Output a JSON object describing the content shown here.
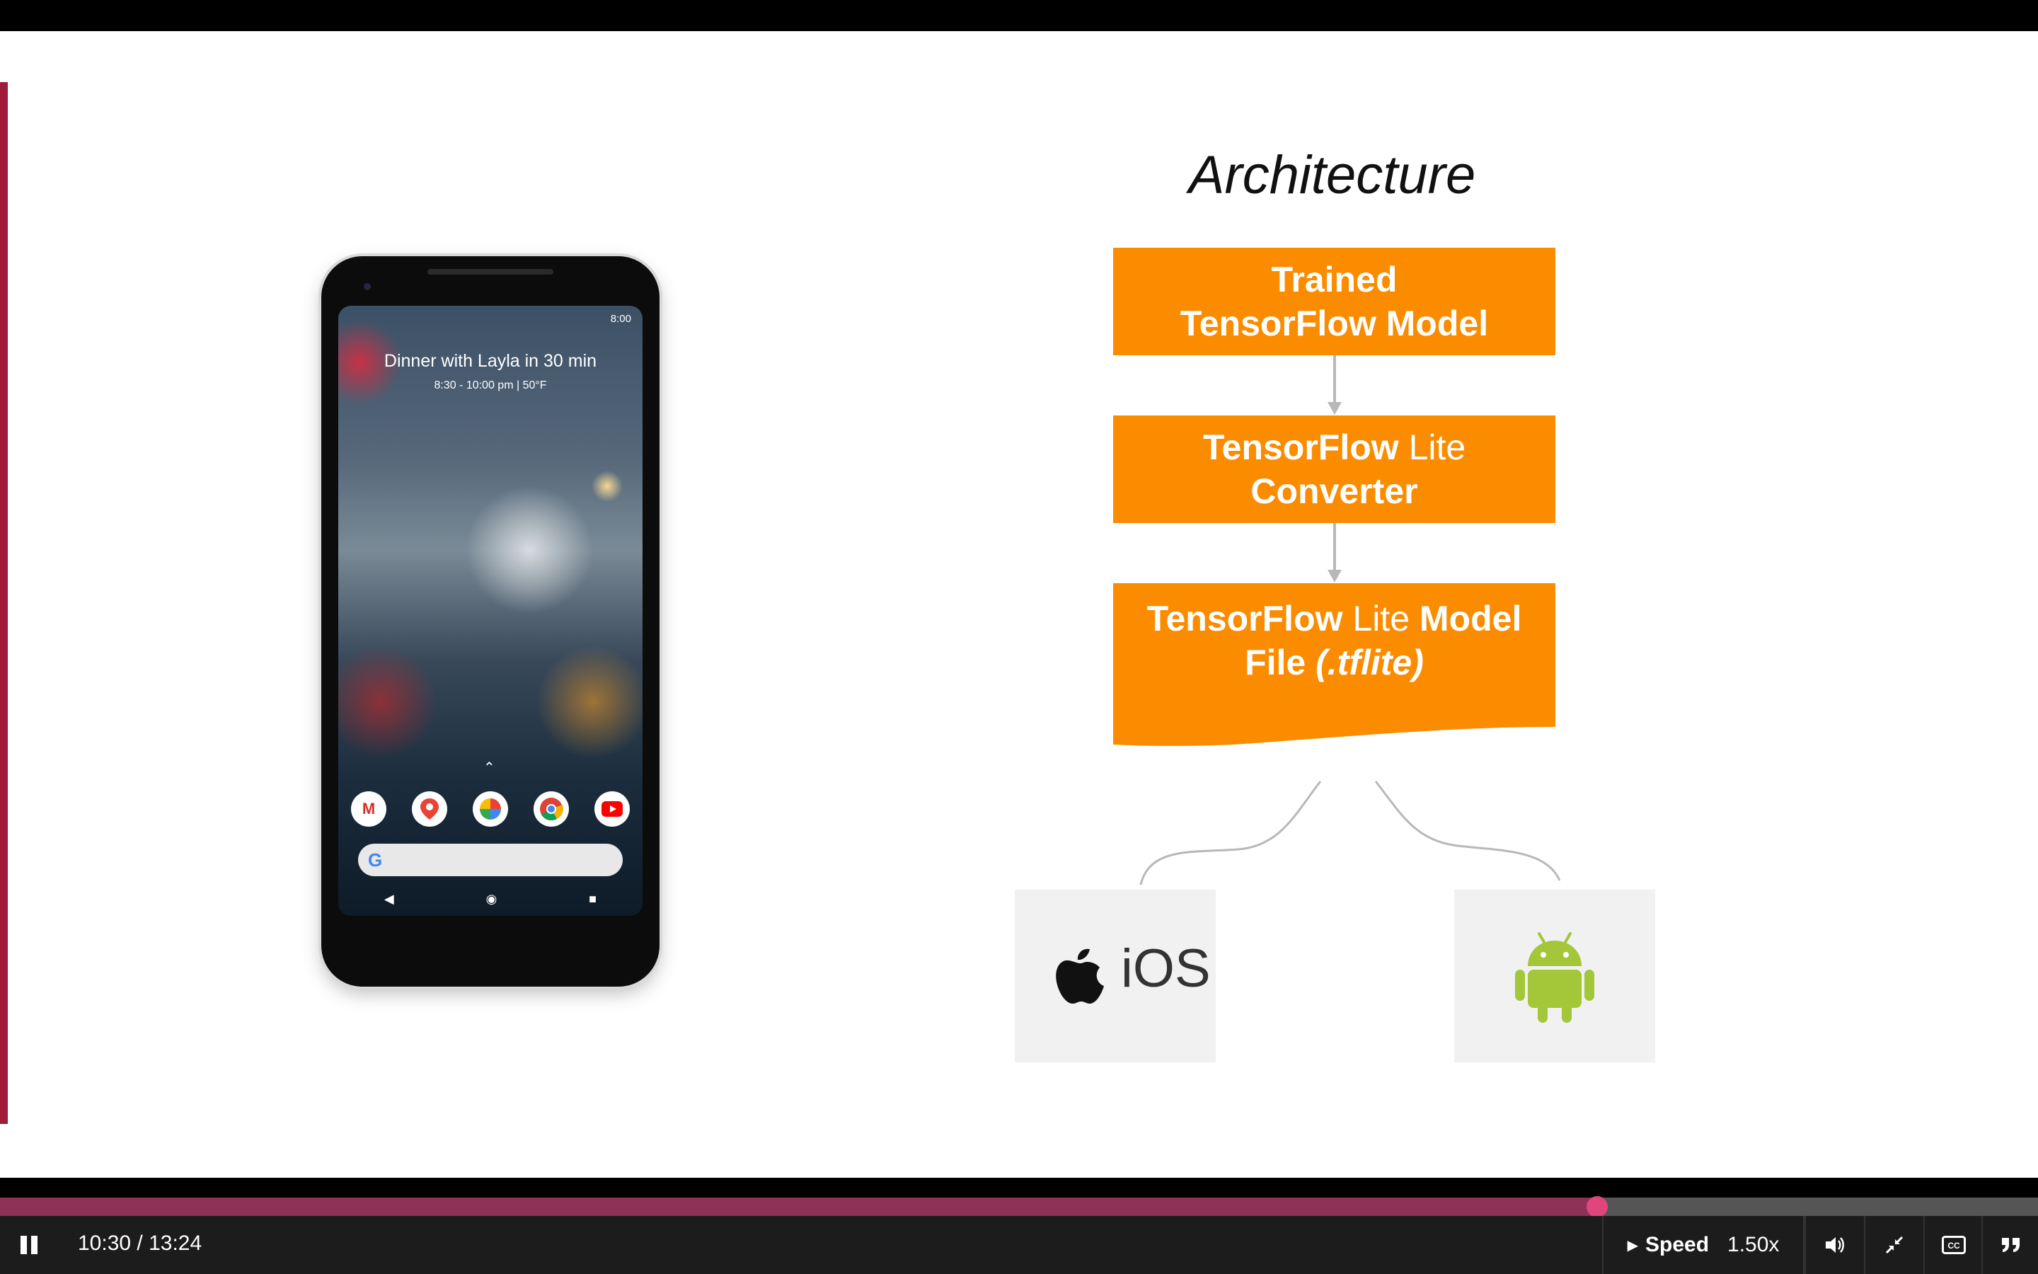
{
  "colors": {
    "accent": "#9e1b3a",
    "box_orange": "#fb8c00",
    "progress_played": "#8e3257",
    "scrubber": "#e0457b",
    "connector_gray": "#b8b8b8",
    "android_green": "#a4c639"
  },
  "slide": {
    "title": "Architecture",
    "boxes": [
      {
        "bold1": "Trained",
        "light1": "",
        "bold2": "TensorFlow Model",
        "light2": "",
        "italic2": ""
      },
      {
        "bold1": "TensorFlow",
        "light1": " Lite",
        "bold2": "Converter",
        "light2": "",
        "italic2": ""
      },
      {
        "bold1": "TensorFlow",
        "light1": " Lite ",
        "bold1b": "Model",
        "bold2": "File ",
        "italic2": "(.tflite)"
      }
    ],
    "platforms": {
      "ios": {
        "label": "iOS",
        "icon": "apple-icon"
      },
      "android": {
        "icon": "android-icon"
      }
    },
    "phone": {
      "status_time": "8:00",
      "event_title": "Dinner with Layla in 30 min",
      "event_detail": "8:30 - 10:00 pm  |  50°F",
      "dock_apps": [
        "gmail-icon",
        "maps-icon",
        "photos-icon",
        "chrome-icon",
        "youtube-icon"
      ],
      "search_logo": "G"
    }
  },
  "player": {
    "current_time": "10:30",
    "total_time": "13:24",
    "time_display": "10:30 / 13:24",
    "progress": 0.7836,
    "speed_label": "Speed",
    "speed_value": "1.50x",
    "buttons": [
      "pause-icon",
      "volume-icon",
      "exit-fullscreen-icon",
      "captions-icon",
      "quote-icon"
    ]
  }
}
